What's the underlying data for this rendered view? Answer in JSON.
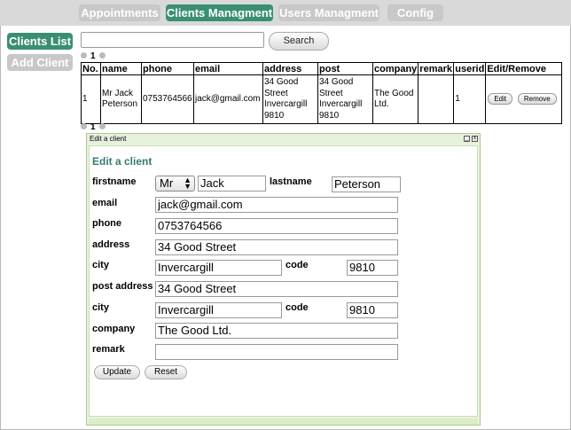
{
  "nav": {
    "tabs": [
      {
        "label": "Appointments"
      },
      {
        "label": "Clients Managment"
      },
      {
        "label": "Users Managment"
      },
      {
        "label": "Config"
      }
    ]
  },
  "sidebar": {
    "clients_list": "Clients List",
    "add_client": "Add Client"
  },
  "search": {
    "value": "",
    "button": "Search"
  },
  "pager": {
    "page": "1"
  },
  "table": {
    "headers": [
      "No.",
      "name",
      "phone",
      "email",
      "address",
      "post",
      "company",
      "remark",
      "userid",
      "Edit/Remove"
    ],
    "rows": [
      {
        "no": "1",
        "name": "Mr Jack Peterson",
        "phone": "0753764566",
        "email": "jack@gmail.com",
        "address": "34 Good Street Invercargill 9810",
        "post": "34 Good Street Invercargill 9810",
        "company": "The Good Ltd.",
        "remark": "",
        "userid": "1",
        "edit": "Edit",
        "remove": "Remove"
      }
    ]
  },
  "dialog": {
    "title": "Edit a client",
    "heading": "Edit a client",
    "labels": {
      "firstname": "firstname",
      "lastname": "lastname",
      "email": "email",
      "phone": "phone",
      "address": "address",
      "city": "city",
      "code": "code",
      "post_address": "post address",
      "post_city": "city",
      "post_code": "code",
      "company": "company",
      "remark": "remark"
    },
    "values": {
      "title_select": "Mr",
      "firstname": "Jack",
      "lastname": "Peterson",
      "email": "jack@gmail.com",
      "phone": "0753764566",
      "address": "34 Good Street",
      "city": "Invercargill",
      "code": "9810",
      "post_address": "34 Good Street",
      "post_city": "Invercargill",
      "post_code": "9810",
      "company": "The Good Ltd.",
      "remark": ""
    },
    "buttons": {
      "update": "Update",
      "reset": "Reset",
      "minimize": "_",
      "close": "x"
    }
  },
  "colors": {
    "accent": "#3a8f73",
    "inactive": "#c8c8c8",
    "heading": "#3a7a70",
    "dialog_border": "#a8c890"
  },
  "icons": {
    "pager_prev": "circle-arrow-left-icon",
    "pager_next": "circle-arrow-right-icon",
    "select_caret": "up-down-caret-icon",
    "minimize": "minimize-icon",
    "close": "close-icon"
  }
}
